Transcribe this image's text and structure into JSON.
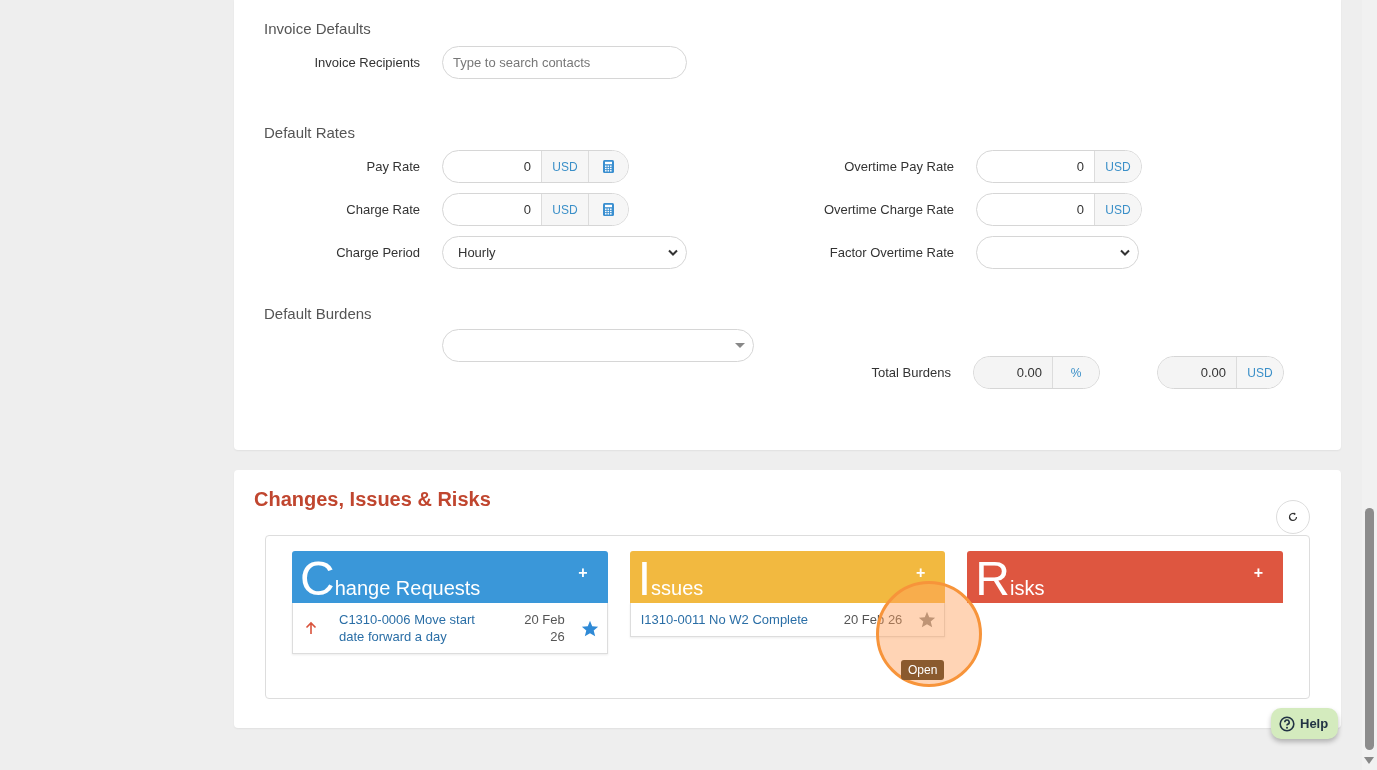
{
  "invoice_defaults": {
    "heading": "Invoice Defaults",
    "recipients": {
      "label": "Invoice Recipients",
      "placeholder": "Type to search contacts"
    }
  },
  "default_rates": {
    "heading": "Default Rates",
    "rows": [
      {
        "left": {
          "label": "Pay Rate",
          "kind": "money",
          "value": "0",
          "unit": "USD",
          "calculator": true
        },
        "right": {
          "label": "Overtime Pay Rate",
          "kind": "money",
          "value": "0",
          "unit": "USD",
          "calculator": false
        }
      },
      {
        "left": {
          "label": "Charge Rate",
          "kind": "money",
          "value": "0",
          "unit": "USD",
          "calculator": true
        },
        "right": {
          "label": "Overtime Charge Rate",
          "kind": "money",
          "value": "0",
          "unit": "USD",
          "calculator": false
        }
      },
      {
        "left": {
          "label": "Charge Period",
          "kind": "select",
          "value": "Hourly"
        },
        "right": {
          "label": "Factor Overtime Rate",
          "kind": "select"
        }
      }
    ]
  },
  "default_burdens": {
    "heading": "Default Burdens",
    "total_label": "Total Burdens",
    "percent": {
      "value": "0.00",
      "unit": "%"
    },
    "amount": {
      "value": "0.00",
      "unit": "USD"
    }
  },
  "cir": {
    "title": "Changes, Issues & Risks",
    "panels": [
      {
        "title": "Change Requests",
        "color": "#3a97d9",
        "add": "+",
        "items": [
          {
            "raised": true,
            "text": "C1310-0006 Move start date forward a day",
            "date": "20 Feb 26",
            "starred": true
          }
        ]
      },
      {
        "title": "Issues",
        "color": "#f2b940",
        "add": "+",
        "items": [
          {
            "raised": false,
            "text": "I1310-0011 No W2 Complete",
            "date": "20 Feb 26",
            "starred": false
          }
        ]
      },
      {
        "title": "Risks",
        "color": "#de5640",
        "add": "+"
      }
    ]
  },
  "tooltip": {
    "text": "Open"
  },
  "help": {
    "label": "Help"
  }
}
